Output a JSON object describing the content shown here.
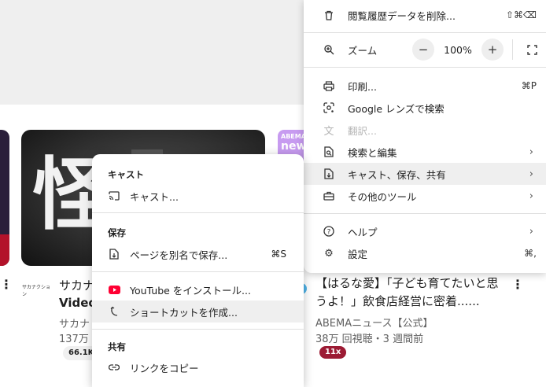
{
  "page": {
    "thumb_kanji": "怪",
    "thumb_right_small": "ABEMA",
    "thumb_right_big": "new",
    "channel_logo_text": "サカナクション",
    "video1": {
      "title_line1": "サカナ",
      "title_line2": "Video",
      "channel": "サカナ",
      "views": "137万",
      "badge": "66.1K V"
    },
    "video2": {
      "title": "【はるな愛】「子ども育てたいと思うよ！」飲食店経営に密着......",
      "channel": "ABEMAニュース【公式】",
      "views": "38万 回視聴・3 週間前",
      "badge": "11x"
    }
  },
  "menu": {
    "clear_history": "閲覧履歴データを削除...",
    "clear_history_sc": "⇧⌘⌫",
    "zoom_label": "ズーム",
    "zoom_value": "100%",
    "zoom_minus": "−",
    "zoom_plus": "+",
    "print": "印刷...",
    "print_sc": "⌘P",
    "google_lens": "Google レンズで検索",
    "translate": "翻訳...",
    "find_edit": "検索と編集",
    "cast_save_share": "キャスト、保存、共有",
    "more_tools": "その他のツール",
    "help": "ヘルプ",
    "settings": "設定",
    "settings_sc": "⌘,"
  },
  "submenu": {
    "cast_header": "キャスト",
    "cast": "キャスト...",
    "save_header": "保存",
    "save_page": "ページを別名で保存...",
    "save_page_sc": "⌘S",
    "install_youtube": "YouTube をインストール...",
    "create_shortcut": "ショートカットを作成...",
    "share_header": "共有",
    "copy_link": "リンクをコピー"
  },
  "colors": {
    "youtube_red": "#ff0033",
    "badge_red": "#9c1b34",
    "highlight": "#efefef"
  }
}
